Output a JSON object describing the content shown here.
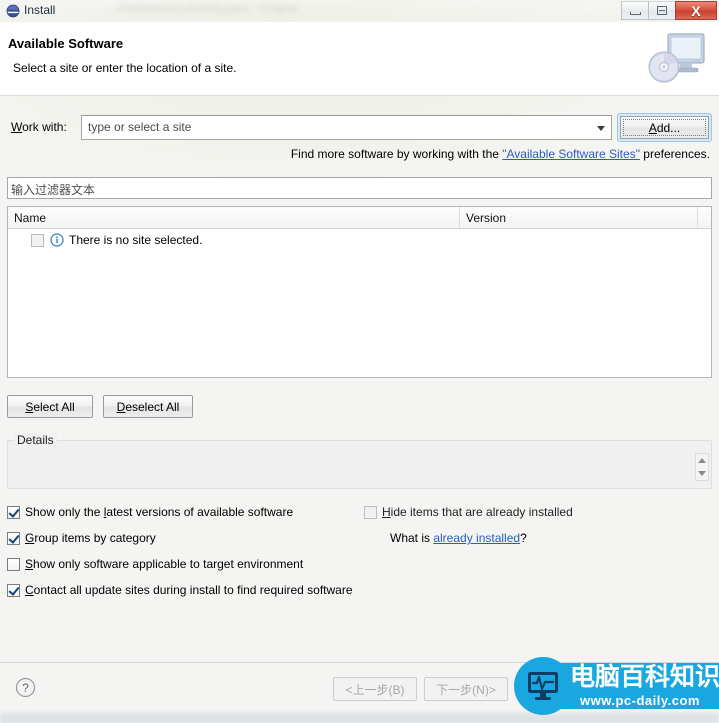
{
  "window": {
    "title": "Install",
    "title_icon": "eclipse-globe-icon",
    "background_text": "...Preferences.Activity.java - Eclipse",
    "controls": {
      "minimize_label": "minimize-icon",
      "maximize_label": "maximize-icon",
      "close_label": "X"
    }
  },
  "header": {
    "title": "Available Software",
    "subtitle": "Select a site or enter the location of a site.",
    "banner_icon": "monitor-with-cd-icon"
  },
  "work_with": {
    "label_pre": "W",
    "label_post": "ork with:",
    "combo_value": "type or select a site",
    "combo_placeholder": "type or select a site",
    "add_button_pre": "A",
    "add_button_post": "dd...",
    "add_button_focused": true
  },
  "find_more": {
    "text_before": "Find more software by working with the ",
    "link_text": "\"Available Software Sites\"",
    "text_after": " preferences."
  },
  "filter": {
    "placeholder": "输入过滤器文本",
    "value": ""
  },
  "table": {
    "columns": [
      {
        "header": "Name"
      },
      {
        "header": "Version"
      },
      {
        "header": ""
      }
    ],
    "rows": [
      {
        "checkbox_checked": false,
        "checkbox_disabled": true,
        "icon": "info-circle-icon",
        "name": "There is no site selected.",
        "version": ""
      }
    ]
  },
  "list_buttons": {
    "select_all_pre": "S",
    "select_all_post": "elect All",
    "deselect_all_pre": "D",
    "deselect_all_post": "eselect All"
  },
  "details": {
    "legend": "Details",
    "content": "",
    "scrollbar": "vertical-spinner"
  },
  "options": [
    {
      "id": "show-latest-versions",
      "checked": true,
      "disabled": false,
      "text_pre": "Show only the ",
      "mnemonic": "l",
      "text_post": "atest versions of available software"
    },
    {
      "id": "group-by-category",
      "checked": true,
      "disabled": false,
      "text_pre": "",
      "mnemonic": "G",
      "text_post": "roup items by category"
    },
    {
      "id": "target-environment",
      "checked": false,
      "disabled": false,
      "text_pre": "",
      "mnemonic": "S",
      "text_post": "how only software applicable to target environment"
    },
    {
      "id": "contact-all-update-sites",
      "checked": true,
      "disabled": false,
      "text_pre": "",
      "mnemonic": "C",
      "text_post": "ontact all update sites during install to find required software"
    },
    {
      "id": "hide-already-installed",
      "checked": false,
      "disabled": true,
      "text_pre": "",
      "mnemonic": "H",
      "text_post": "ide items that are already installed"
    }
  ],
  "what_is": {
    "text_before": "What is ",
    "link_text": "already installed",
    "text_after": "?"
  },
  "footer": {
    "help_icon": "help-question-icon",
    "back_label": "<上一步(B)",
    "next_label": "下一步(N)>",
    "back_disabled": true,
    "next_disabled": true
  },
  "watermark": {
    "brand_cn": "电脑百科知识",
    "url": "www.pc-daily.com",
    "icon": "monitor-heartbeat-icon",
    "color": "#1aa7e0"
  },
  "colors": {
    "dialog_bg": "#f0f0f0",
    "header_bg": "#ffffff",
    "link": "#2b5fb3",
    "accent_focus": "#9cc4e4",
    "close_btn": "#d9543f",
    "watermark": "#1aa7e0"
  }
}
